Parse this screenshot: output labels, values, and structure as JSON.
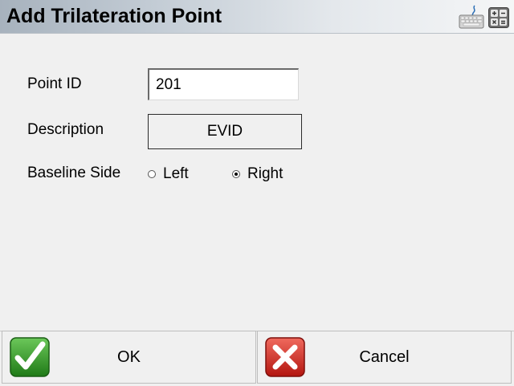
{
  "window": {
    "title": "Add Trilateration Point",
    "toolbar_icons": [
      "keyboard-icon",
      "calculator-icon"
    ]
  },
  "form": {
    "point_id": {
      "label": "Point ID",
      "value": "201"
    },
    "description": {
      "label": "Description",
      "value": "EVID"
    },
    "baseline_side": {
      "label": "Baseline Side",
      "options": [
        "Left",
        "Right"
      ],
      "selected": "Right"
    }
  },
  "footer": {
    "ok_label": "OK",
    "cancel_label": "Cancel"
  },
  "colors": {
    "background": "#f0f0f0",
    "ok_icon_green": "#2e8b1f",
    "cancel_icon_red": "#c8201e"
  }
}
